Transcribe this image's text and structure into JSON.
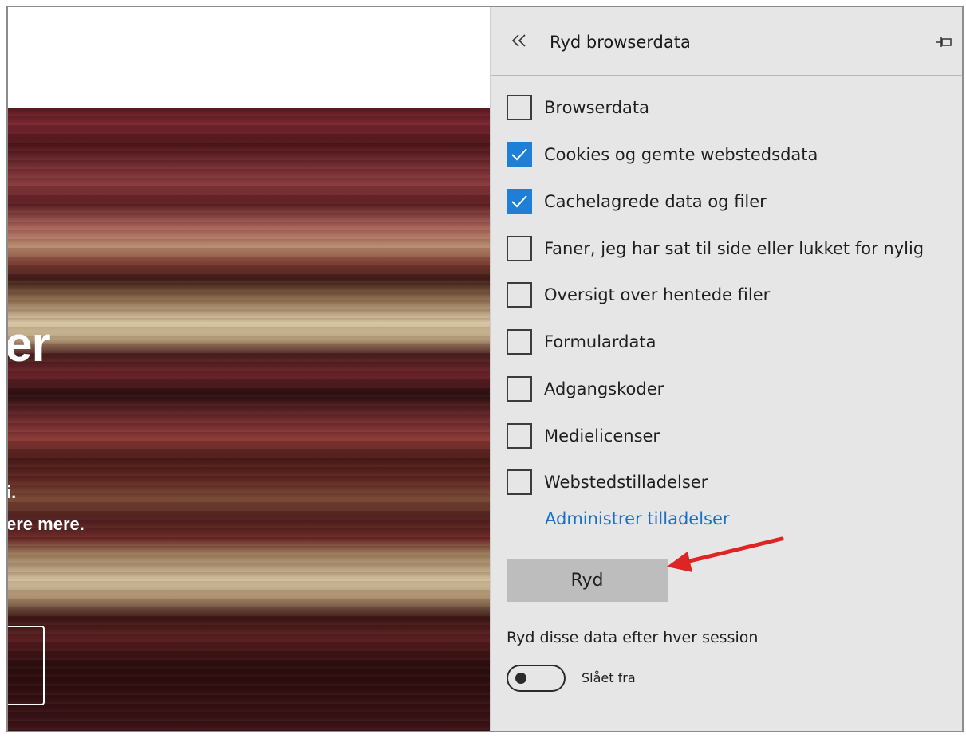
{
  "web": {
    "heading_fragment": "er",
    "line1_fragment": "i.",
    "line2_fragment": "ere mere."
  },
  "panel": {
    "title": "Ryd browserdata",
    "options": [
      {
        "label": "Browserdata",
        "checked": false
      },
      {
        "label": "Cookies og gemte webstedsdata",
        "checked": true
      },
      {
        "label": "Cachelagrede data og filer",
        "checked": true
      },
      {
        "label": "Faner, jeg har sat til side eller lukket for nylig",
        "checked": false
      },
      {
        "label": "Oversigt over hentede filer",
        "checked": false
      },
      {
        "label": "Formulardata",
        "checked": false
      },
      {
        "label": "Adgangskoder",
        "checked": false
      },
      {
        "label": "Medielicenser",
        "checked": false
      },
      {
        "label": "Webstedstilladelser",
        "checked": false
      }
    ],
    "manage_link": "Administrer tilladelser",
    "clear_button": "Ryd",
    "session_label": "Ryd disse data efter hver session",
    "toggle": {
      "state": "off",
      "label": "Slået fra"
    }
  },
  "icons": {
    "collapse": "double-chevron-left-icon",
    "pin": "pin-icon",
    "check": "checkmark-icon"
  },
  "colors": {
    "panel_bg": "#e6e6e6",
    "accent": "#1f7fd6",
    "link": "#1a6fc2",
    "button_bg": "#bdbdbd",
    "annotation_arrow": "#e02424"
  }
}
